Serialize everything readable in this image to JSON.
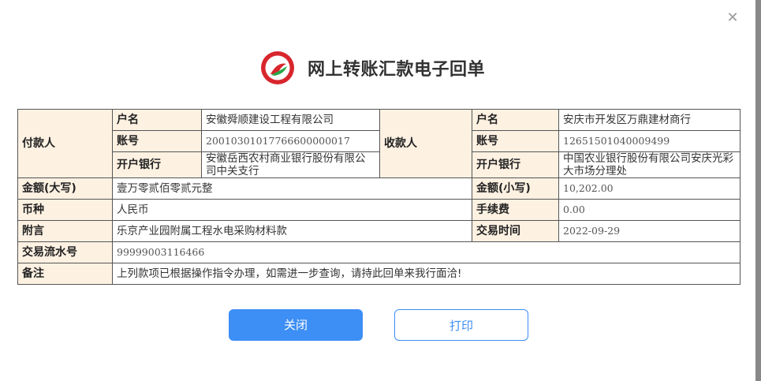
{
  "header": {
    "title": "网上转账汇款电子回单"
  },
  "colors": {
    "label_bg": "#fdf1e2",
    "primary": "#3d8ef5",
    "logo_red": "#d8262d",
    "logo_green": "#2aa84a"
  },
  "payer": {
    "section_label": "付款人",
    "name_label": "户名",
    "name": "安徽舜顺建设工程有限公司",
    "account_label": "账号",
    "account": "20010301017766600000017",
    "bank_label": "开户银行",
    "bank": "安徽岳西农村商业银行股份有限公司中关支行"
  },
  "payee": {
    "section_label": "收款人",
    "name_label": "户名",
    "name": "安庆市开发区万鼎建材商行",
    "account_label": "账号",
    "account": "12651501040009499",
    "bank_label": "开户银行",
    "bank": "中国农业银行股份有限公司安庆光彩大市场分理处"
  },
  "amount": {
    "upper_label": "金额(大写)",
    "upper": "壹万零贰佰零贰元整",
    "lower_label": "金额(小写)",
    "lower": "10,202.00"
  },
  "currency": {
    "label": "币种",
    "value": "人民币"
  },
  "fee": {
    "label": "手续费",
    "value": "0.00"
  },
  "remark": {
    "label": "附言",
    "value": "乐京产业园附属工程水电采购材料款"
  },
  "trade_time": {
    "label": "交易时间",
    "value": "2022-09-29"
  },
  "serial": {
    "label": "交易流水号",
    "value": "99999003116466"
  },
  "note": {
    "label": "备注",
    "value": "上列款项已根据操作指令办理，如需进一步查询，请持此回单来我行面洽!"
  },
  "buttons": {
    "close": "关闭",
    "print": "打印"
  },
  "icons": {
    "close": "close-icon",
    "logo": "bank-logo"
  }
}
